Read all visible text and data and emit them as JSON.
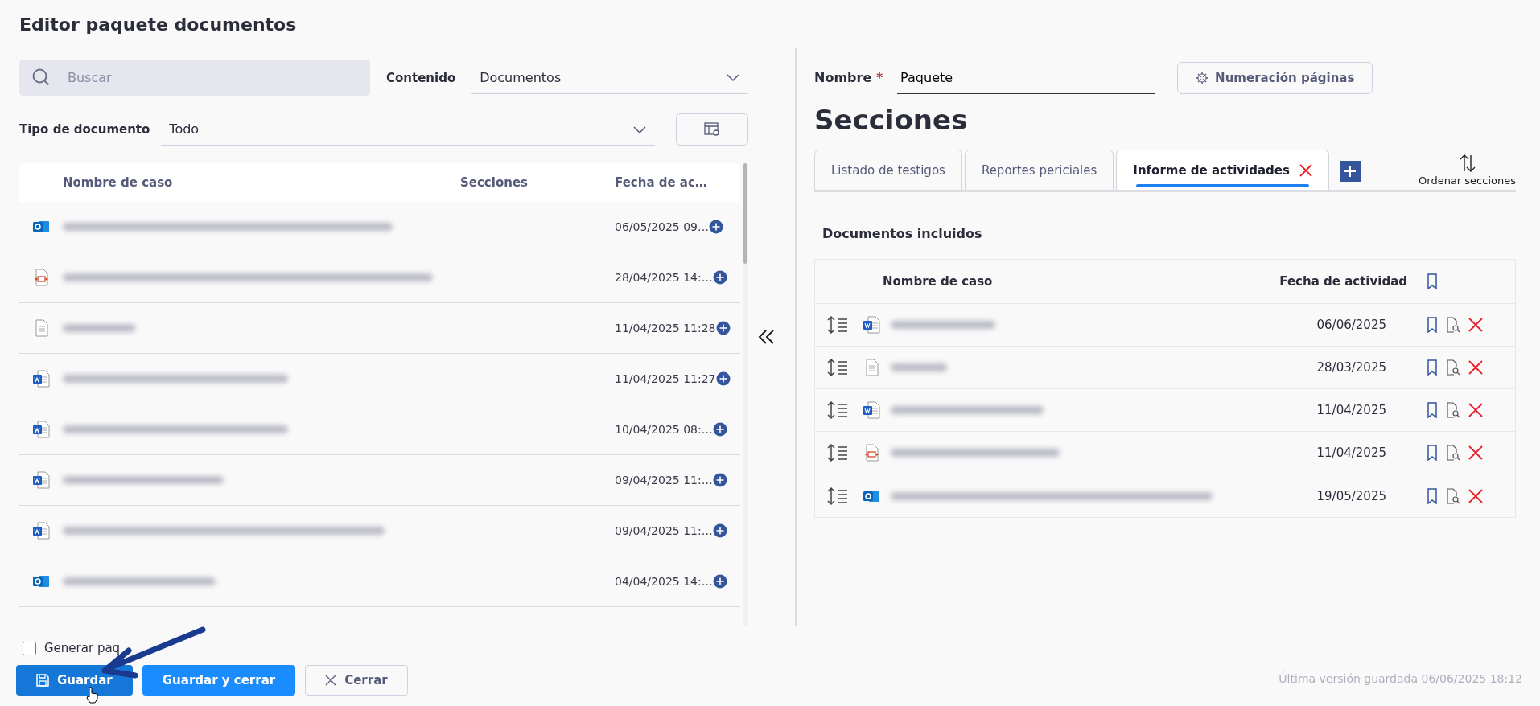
{
  "title": "Editor paquete documentos",
  "search": {
    "placeholder": "Buscar"
  },
  "content_filter": {
    "label": "Contenido",
    "value": "Documentos"
  },
  "doc_type_filter": {
    "label": "Tipo de documento",
    "value": "Todo"
  },
  "available": {
    "columns": [
      "Nombre de caso",
      "Secciones",
      "Fecha de ac…"
    ],
    "rows": [
      {
        "kind": "outlook",
        "date": "06/05/2025 09…"
      },
      {
        "kind": "pdf",
        "date": "28/04/2025 14:…"
      },
      {
        "kind": "text",
        "date": "11/04/2025 11:28"
      },
      {
        "kind": "word",
        "date": "11/04/2025 11:27"
      },
      {
        "kind": "word",
        "date": "10/04/2025 08:…"
      },
      {
        "kind": "word",
        "date": "09/04/2025 11:…"
      },
      {
        "kind": "word",
        "date": "09/04/2025 11:…"
      },
      {
        "kind": "outlook",
        "date": "04/04/2025 14:…"
      }
    ]
  },
  "name_field": {
    "label": "Nombre",
    "required_mark": "*",
    "value": "Paquete"
  },
  "page_numbering_button": "Numeración páginas",
  "sections_heading": "Secciones",
  "tabs": [
    {
      "label": "Listado de testigos",
      "selected": false
    },
    {
      "label": "Reportes periciales",
      "selected": false
    },
    {
      "label": "Informe de actividades",
      "selected": true
    }
  ],
  "sort_sections": "Ordenar secciones",
  "included": {
    "heading": "Documentos incluidos",
    "columns": [
      "Nombre de caso",
      "Fecha de actividad"
    ],
    "rows": [
      {
        "kind": "word",
        "date": "06/06/2025"
      },
      {
        "kind": "text",
        "date": "28/03/2025"
      },
      {
        "kind": "word",
        "date": "11/04/2025"
      },
      {
        "kind": "pdf",
        "date": "11/04/2025"
      },
      {
        "kind": "outlook",
        "date": "19/05/2025"
      }
    ]
  },
  "footer": {
    "generate_checkbox": {
      "label": "Generar paq",
      "checked": false
    },
    "buttons": [
      {
        "label": "Guardar",
        "kind": "save"
      },
      {
        "label": "Guardar y cerrar",
        "kind": "primary"
      },
      {
        "label": "Cerrar",
        "kind": "close"
      }
    ],
    "last_saved": "Última versión guardada 06/06/2025 18:12"
  }
}
